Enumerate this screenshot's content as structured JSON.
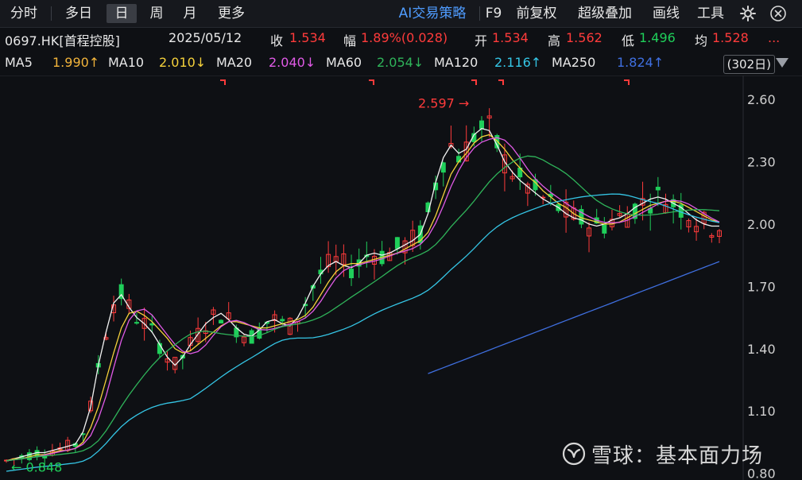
{
  "toolbar": {
    "tabs": [
      "分时",
      "多日",
      "日",
      "周",
      "月",
      "更多"
    ],
    "active_tab": "日",
    "ai_label": "AI交易策略",
    "f9": "F9",
    "adjust": "前复权",
    "overlay": "超级叠加",
    "draw": "画线",
    "tools": "工具",
    "icons": [
      "gear-icon",
      "close-icon"
    ]
  },
  "quote": {
    "code": "0697.HK[首程控股]",
    "date": "2025/05/12",
    "close_label": "收",
    "close": "1.534",
    "change_label": "幅",
    "change": "1.89%(0.028)",
    "open_label": "开",
    "open": "1.534",
    "high_label": "高",
    "high": "1.562",
    "low_label": "低",
    "low": "1.496",
    "avg_label": "均",
    "avg": "1.528",
    "more": "..."
  },
  "ma_bar": {
    "ma5_label": "MA5",
    "ma5": "1.990↑",
    "ma10_label": "MA10",
    "ma10": "2.010↓",
    "ma20_label": "MA20",
    "ma20": "2.040↓",
    "ma60_label": "MA60",
    "ma60": "2.054↓",
    "ma120_label": "MA120",
    "ma120": "2.116↑",
    "ma250_label": "MA250",
    "ma250": "1.824↑",
    "days": "(302日)"
  },
  "colors": {
    "up": "#ff3b3b",
    "down": "#1fcf5a",
    "ma5": "#f2f2f2",
    "ma10": "#f5d13b",
    "ma20": "#e05ae6",
    "ma60": "#2fb45a",
    "ma120": "#35c6e6",
    "ma250": "#3f6fe0",
    "ai": "#4f9cff"
  },
  "chart_data": {
    "type": "candlestick",
    "ylim": [
      0.8,
      2.62
    ],
    "yticks": [
      "2.60",
      "2.30",
      "2.00",
      "1.70",
      "1.40",
      "1.10",
      "0.80"
    ],
    "annotations": {
      "max_label": "2.597",
      "min_label": "0.848"
    },
    "series": [
      {
        "name": "MA5",
        "values": [
          0.86,
          0.87,
          0.88,
          0.89,
          0.9,
          0.9,
          0.91,
          0.92,
          0.93,
          0.94,
          1.0,
          1.12,
          1.32,
          1.48,
          1.62,
          1.66,
          1.6,
          1.55,
          1.52,
          1.48,
          1.42,
          1.36,
          1.32,
          1.36,
          1.42,
          1.47,
          1.52,
          1.55,
          1.57,
          1.54,
          1.5,
          1.47,
          1.46,
          1.49,
          1.53,
          1.54,
          1.52,
          1.51,
          1.55,
          1.62,
          1.7,
          1.76,
          1.8,
          1.82,
          1.8,
          1.79,
          1.81,
          1.85,
          1.86,
          1.85,
          1.86,
          1.88,
          1.9,
          1.92,
          1.95,
          2.05,
          2.2,
          2.32,
          2.38,
          2.34,
          2.36,
          2.43,
          2.46,
          2.45,
          2.38,
          2.3,
          2.25,
          2.21,
          2.18,
          2.15,
          2.12,
          2.1,
          2.08,
          2.05,
          2.03,
          2.02,
          2.0,
          1.99,
          2.0,
          2.02,
          2.03,
          2.05,
          2.08,
          2.1,
          2.12,
          2.13,
          2.12,
          2.1,
          2.08,
          2.05,
          2.02,
          2.0,
          1.99,
          1.99
        ]
      },
      {
        "name": "MA10",
        "values": [
          0.86,
          0.87,
          0.87,
          0.88,
          0.89,
          0.89,
          0.9,
          0.91,
          0.91,
          0.92,
          0.95,
          1.02,
          1.12,
          1.25,
          1.38,
          1.5,
          1.57,
          1.58,
          1.56,
          1.53,
          1.49,
          1.45,
          1.4,
          1.38,
          1.39,
          1.42,
          1.45,
          1.48,
          1.51,
          1.53,
          1.53,
          1.52,
          1.51,
          1.5,
          1.5,
          1.51,
          1.52,
          1.53,
          1.54,
          1.56,
          1.6,
          1.66,
          1.72,
          1.77,
          1.8,
          1.81,
          1.81,
          1.82,
          1.83,
          1.84,
          1.85,
          1.86,
          1.88,
          1.9,
          1.92,
          1.96,
          2.04,
          2.14,
          2.24,
          2.3,
          2.34,
          2.39,
          2.42,
          2.43,
          2.4,
          2.36,
          2.31,
          2.27,
          2.23,
          2.2,
          2.16,
          2.13,
          2.1,
          2.08,
          2.05,
          2.03,
          2.02,
          2.01,
          2.0,
          2.0,
          2.01,
          2.03,
          2.05,
          2.07,
          2.09,
          2.1,
          2.11,
          2.11,
          2.1,
          2.08,
          2.06,
          2.04,
          2.02,
          2.01
        ]
      }
    ]
  },
  "watermark": "雪球：基本面力场"
}
